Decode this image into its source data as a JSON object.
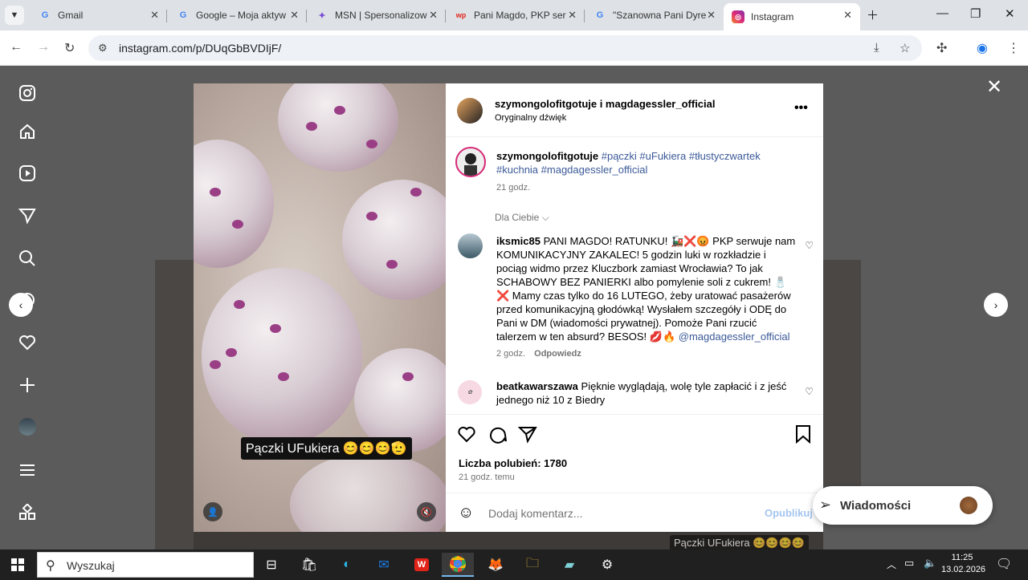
{
  "browser": {
    "tabs": [
      {
        "title": "Gmail",
        "favicon": "gmail-icon"
      },
      {
        "title": "Google – Moja aktyw",
        "favicon": "google-icon"
      },
      {
        "title": "MSN | Spersonalizow",
        "favicon": "msn-icon"
      },
      {
        "title": "Pani Magdo, PKP ser",
        "favicon": "wp-icon"
      },
      {
        "title": "\"Szanowna Pani Dyre",
        "favicon": "google-icon"
      },
      {
        "title": "Instagram",
        "favicon": "instagram-icon",
        "active": true
      }
    ],
    "url": "instagram.com/p/DUqGbBVDIjF/"
  },
  "post": {
    "header_users": "szymongolofitgotuje i magdagessler_official",
    "header_subtitle": "Oryginalny dźwięk",
    "video_caption": "Pączki UFukiera 😊😊😊🫡",
    "caption": {
      "user": "szymongolofitgotuje",
      "text": "#pączki #uFukiera #tłustyczwartek #kuchnia #magdagessler_official",
      "time": "21 godz."
    },
    "sort_label": "Dla Ciebie",
    "comments": [
      {
        "user": "iksmic85",
        "text": "PANI MAGDO! RATUNKU! 🚂❌😡 PKP serwuje nam KOMUNIKACYJNY ZAKALEC! 5 godzin luki w rozkładzie i pociąg widmo przez Kluczbork zamiast Wrocławia? To jak SCHABOWY BEZ PANIERKI albo pomylenie soli z cukrem! 🧂❌ Mamy czas tylko do 16 LUTEGO, żeby uratować pasażerów przed komunikacyjną głodówką! Wysłałem szczegóły i ODĘ do Pani w DM (wiadomości prywatnej). Pomoże Pani rzucić talerzem w ten absurd? BESOS! 💋🔥",
        "mention": "@magdagessler_official",
        "time": "2 godz.",
        "reply": "Odpowiedz"
      },
      {
        "user": "beatkawarszawa",
        "text": "Pięknie wyglądają, wolę tyle zapłacić i z jeść jednego niż 10 z Biedry"
      }
    ],
    "likes": "Liczba polubień: 1780",
    "posted": "21 godz. temu",
    "comment_placeholder": "Dodaj komentarz...",
    "publish_label": "Opublikuj"
  },
  "messages_pill": "Wiadomości",
  "bg_caption": "Pączki UFukiera 😊😊😊😊",
  "taskbar": {
    "search_placeholder": "Wyszukaj",
    "time": "11:25",
    "date": "13.02.2026"
  }
}
